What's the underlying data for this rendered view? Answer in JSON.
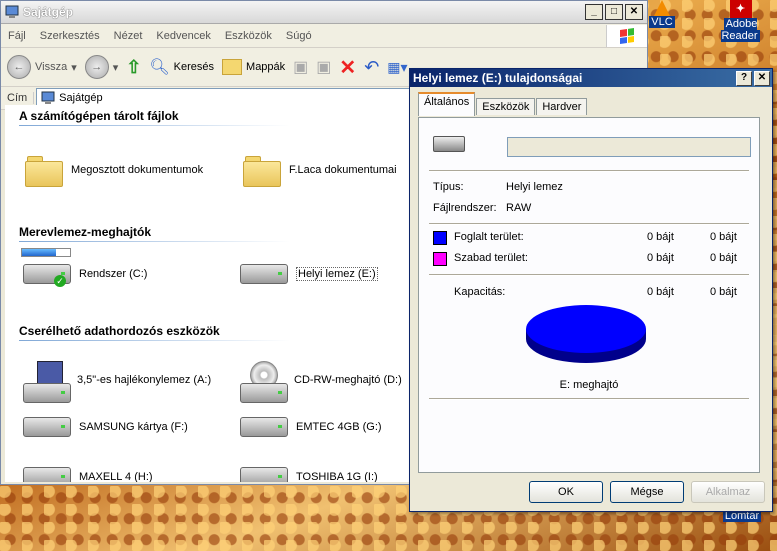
{
  "explorer": {
    "title": "Sajátgép",
    "menu": [
      "Fájl",
      "Szerkesztés",
      "Nézet",
      "Kedvencek",
      "Eszközök",
      "Súgó"
    ],
    "toolbar": {
      "back": "Vissza",
      "search": "Keresés",
      "folders": "Mappák"
    },
    "address_label": "Cím",
    "address_value": "Sajátgép",
    "sections": {
      "files": "A számítógépen tárolt fájlok",
      "hdd": "Merevlemez-meghajtók",
      "removable": "Cserélhető adathordozós eszközök"
    },
    "items": {
      "shared_docs": "Megosztott dokumentumok",
      "flaca_docs": "F.Laca dokumentumai",
      "system_c": "Rendszer (C:)",
      "local_e": "Helyi lemez (E:)",
      "floppy_a": "3,5\"-es hajlékonylemez (A:)",
      "cdrw_d": "CD-RW-meghajtó (D:)",
      "samsung_f": "SAMSUNG kártya (F:)",
      "emtec_g": "EMTEC 4GB (G:)",
      "maxell_h": "MAXELL 4 (H:)",
      "toshiba_i": "TOSHIBA 1G (I:)"
    }
  },
  "desktop": {
    "vlc": "VLC",
    "adobe": "Adobe Reader",
    "trash": "Lomtár"
  },
  "dialog": {
    "title": "Helyi lemez (E:) tulajdonságai",
    "tabs": [
      "Általános",
      "Eszközök",
      "Hardver"
    ],
    "type_label": "Típus:",
    "type_value": "Helyi lemez",
    "fs_label": "Fájlrendszer:",
    "fs_value": "RAW",
    "used_label": "Foglalt terület:",
    "used_bytes": "0 bájt",
    "used_size": "0 bájt",
    "free_label": "Szabad terület:",
    "free_bytes": "0 bájt",
    "free_size": "0 bájt",
    "cap_label": "Kapacitás:",
    "cap_bytes": "0 bájt",
    "cap_size": "0 bájt",
    "drive_caption": "E: meghajtó",
    "ok": "OK",
    "cancel": "Mégse",
    "apply": "Alkalmaz",
    "colors": {
      "used": "#0000ff",
      "free": "#ff00ff"
    }
  }
}
